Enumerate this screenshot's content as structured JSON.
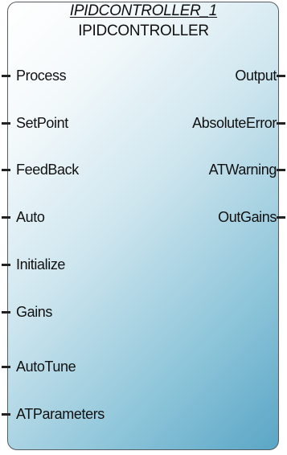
{
  "block": {
    "instance_name": "IPIDCONTROLLER_1",
    "type_name": "IPIDCONTROLLER"
  },
  "inputs": [
    {
      "label": "Process"
    },
    {
      "label": "SetPoint"
    },
    {
      "label": "FeedBack"
    },
    {
      "label": "Auto"
    },
    {
      "label": "Initialize"
    },
    {
      "label": "Gains"
    },
    {
      "label": "AutoTune"
    },
    {
      "label": "ATParameters"
    }
  ],
  "outputs": [
    {
      "label": "Output"
    },
    {
      "label": "AbsoluteError"
    },
    {
      "label": "ATWarning"
    },
    {
      "label": "OutGains"
    }
  ]
}
